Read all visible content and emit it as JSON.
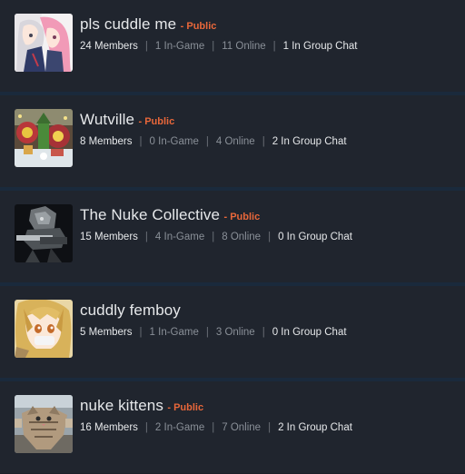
{
  "groups": [
    {
      "name": "pls cuddle me",
      "visibility": "- Public",
      "members": "24 Members",
      "in_game": "1 In-Game",
      "online": "11 Online",
      "group_chat": "1 In Group Chat",
      "avatar_icon": "anime-couple-avatar"
    },
    {
      "name": "Wutville",
      "visibility": "- Public",
      "members": "8 Members",
      "in_game": "0 In-Game",
      "online": "4 Online",
      "group_chat": "2 In Group Chat",
      "avatar_icon": "christmas-town-avatar"
    },
    {
      "name": "The Nuke Collective",
      "visibility": "- Public",
      "members": "15 Members",
      "in_game": "4 In-Game",
      "online": "8 Online",
      "group_chat": "0 In Group Chat",
      "avatar_icon": "armored-gunner-avatar"
    },
    {
      "name": "cuddly femboy",
      "visibility": "",
      "members": "5 Members",
      "in_game": "1 In-Game",
      "online": "3 Online",
      "group_chat": "0 In Group Chat",
      "avatar_icon": "blonde-anime-avatar"
    },
    {
      "name": "nuke kittens",
      "visibility": "- Public",
      "members": "16 Members",
      "in_game": "2 In-Game",
      "online": "7 Online",
      "group_chat": "2 In Group Chat",
      "avatar_icon": "tabby-cat-avatar"
    }
  ],
  "colors": {
    "background": "#1b1f27",
    "row": "#20252e",
    "divider": "#1a2a3c",
    "public_accent": "#e8673a",
    "text_primary": "#e6e8ea",
    "text_secondary": "#8a9098"
  }
}
